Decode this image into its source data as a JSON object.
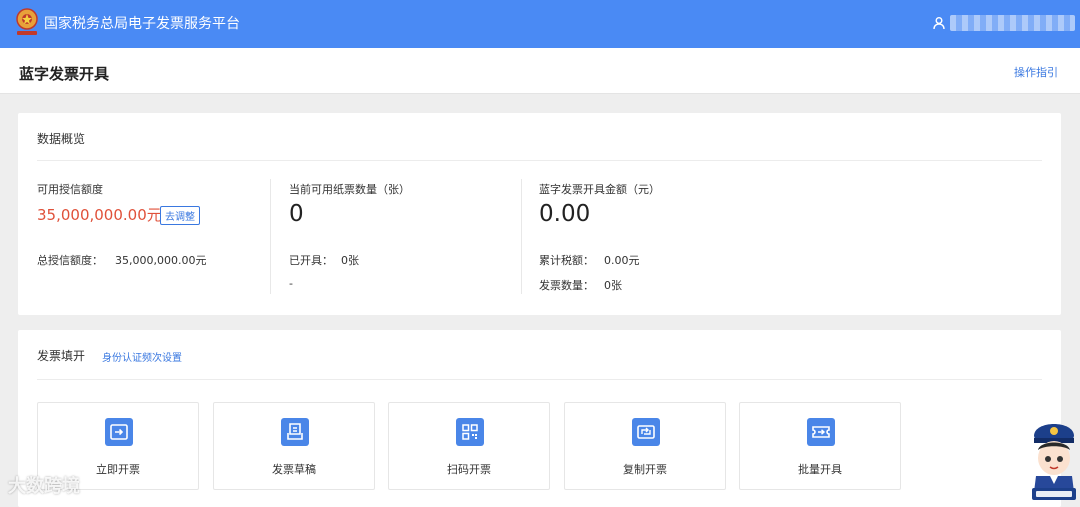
{
  "topbar": {
    "brand": "国家税务总局电子发票服务平台",
    "user_name": "user"
  },
  "subheader": {
    "title": "蓝字发票开具",
    "guide_link": "操作指引"
  },
  "overview": {
    "title": "数据概览",
    "credit": {
      "label": "可用授信额度",
      "amount": "35,000,000.00元",
      "adjust_button": "去调整",
      "total_label": "总授信额度：",
      "total_value": "35,000,000.00元"
    },
    "paper": {
      "label": "当前可用纸票数量（张）",
      "value": "0",
      "issued_label": "已开具：",
      "issued_value": "0张",
      "dash": "-"
    },
    "blue_amount": {
      "label": "蓝字发票开具金额（元）",
      "value": "0.00",
      "tax_label": "累计税额：",
      "tax_value": "0.00元",
      "count_label": "发票数量：",
      "count_value": "0张"
    }
  },
  "invoice_fill": {
    "title": "发票填开",
    "verify_link": "身份认证频次设置",
    "tiles": [
      {
        "label": "立即开票",
        "icon": "issue-invoice-icon"
      },
      {
        "label": "发票草稿",
        "icon": "invoice-draft-icon"
      },
      {
        "label": "扫码开票",
        "icon": "qr-code-icon"
      },
      {
        "label": "复制开票",
        "icon": "copy-invoice-icon"
      },
      {
        "label": "批量开具",
        "icon": "batch-issue-icon"
      }
    ]
  },
  "watermark": "大数跨境",
  "colors": {
    "topbar": "#4a8af4",
    "accent": "#3a78e0",
    "amount_red": "#e0513a",
    "tile_icon": "#4a86e8"
  }
}
